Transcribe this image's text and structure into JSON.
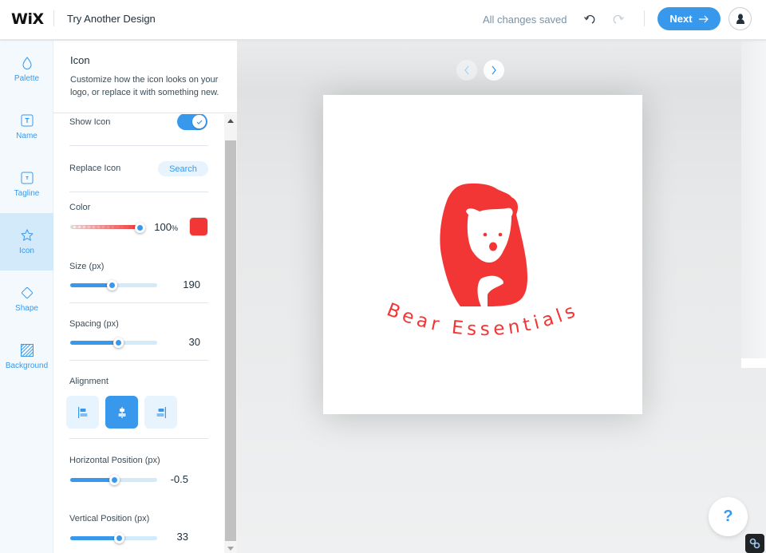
{
  "topbar": {
    "logo": "WiX",
    "title": "Try Another Design",
    "save_status": "All changes saved",
    "undo_icon": "undo-icon",
    "redo_icon": "redo-icon",
    "next_label": "Next",
    "next_icon": "arrow-right-icon",
    "avatar_icon": "user-icon"
  },
  "rail": {
    "items": [
      {
        "label": "Palette",
        "icon": "droplet-icon",
        "active": false
      },
      {
        "label": "Name",
        "icon": "text-box-icon",
        "active": false
      },
      {
        "label": "Tagline",
        "icon": "text-box-small-icon",
        "active": false
      },
      {
        "label": "Icon",
        "icon": "star-icon",
        "active": true
      },
      {
        "label": "Shape",
        "icon": "diamond-icon",
        "active": false
      },
      {
        "label": "Background",
        "icon": "hatched-square-icon",
        "active": false
      }
    ]
  },
  "panel": {
    "title": "Icon",
    "description": "Customize how the icon looks on your logo, or replace it with something new.",
    "show_icon": {
      "label": "Show Icon",
      "enabled": true
    },
    "replace_icon": {
      "label": "Replace Icon",
      "button": "Search"
    },
    "color": {
      "label": "Color",
      "opacity_percent": 100,
      "opacity_value": "100",
      "unit": "%",
      "swatch": "#f23535"
    },
    "size": {
      "label": "Size (px)",
      "value": "190",
      "slider_fraction": 0.48
    },
    "spacing": {
      "label": "Spacing (px)",
      "value": "30",
      "slider_fraction": 0.55
    },
    "alignment": {
      "label": "Alignment",
      "options": [
        "left",
        "center",
        "right"
      ],
      "selected": "center"
    },
    "horizontal_position": {
      "label": "Horizontal Position (px)",
      "value": "-0.5",
      "slider_fraction": 0.5
    },
    "vertical_position": {
      "label": "Vertical Position (px)",
      "value": "33",
      "slider_fraction": 0.56
    }
  },
  "stage": {
    "logo_text": "Bear Essentials",
    "logo_color": "#f23535",
    "prev_icon": "chevron-left-icon",
    "next_icon": "chevron-right-icon",
    "help_label": "?",
    "accent": "#3899ec"
  }
}
